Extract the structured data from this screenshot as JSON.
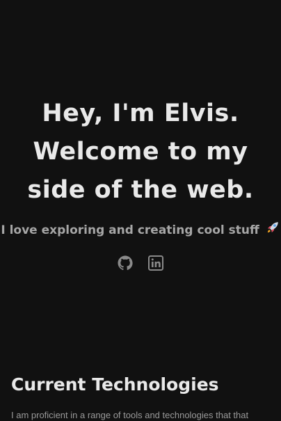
{
  "hero": {
    "title_lines": [
      "Hey, I'm Elvis.",
      "Welcome to my",
      "side of the web."
    ],
    "subtitle": "I love exploring and creating cool stuff",
    "subtitle_emoji": "rocket-icon"
  },
  "social": [
    {
      "icon": "github-icon"
    },
    {
      "icon": "linkedin-icon"
    }
  ],
  "technologies": {
    "heading": "Current Technologies",
    "intro": "I am proficient in a range of tools and technologies that that"
  },
  "colors": {
    "background": "#111111",
    "heading": "#e9e9e9",
    "subtitle": "#a6a6a6",
    "body_text": "#9a9a9a",
    "icon": "#8a8a8a"
  }
}
